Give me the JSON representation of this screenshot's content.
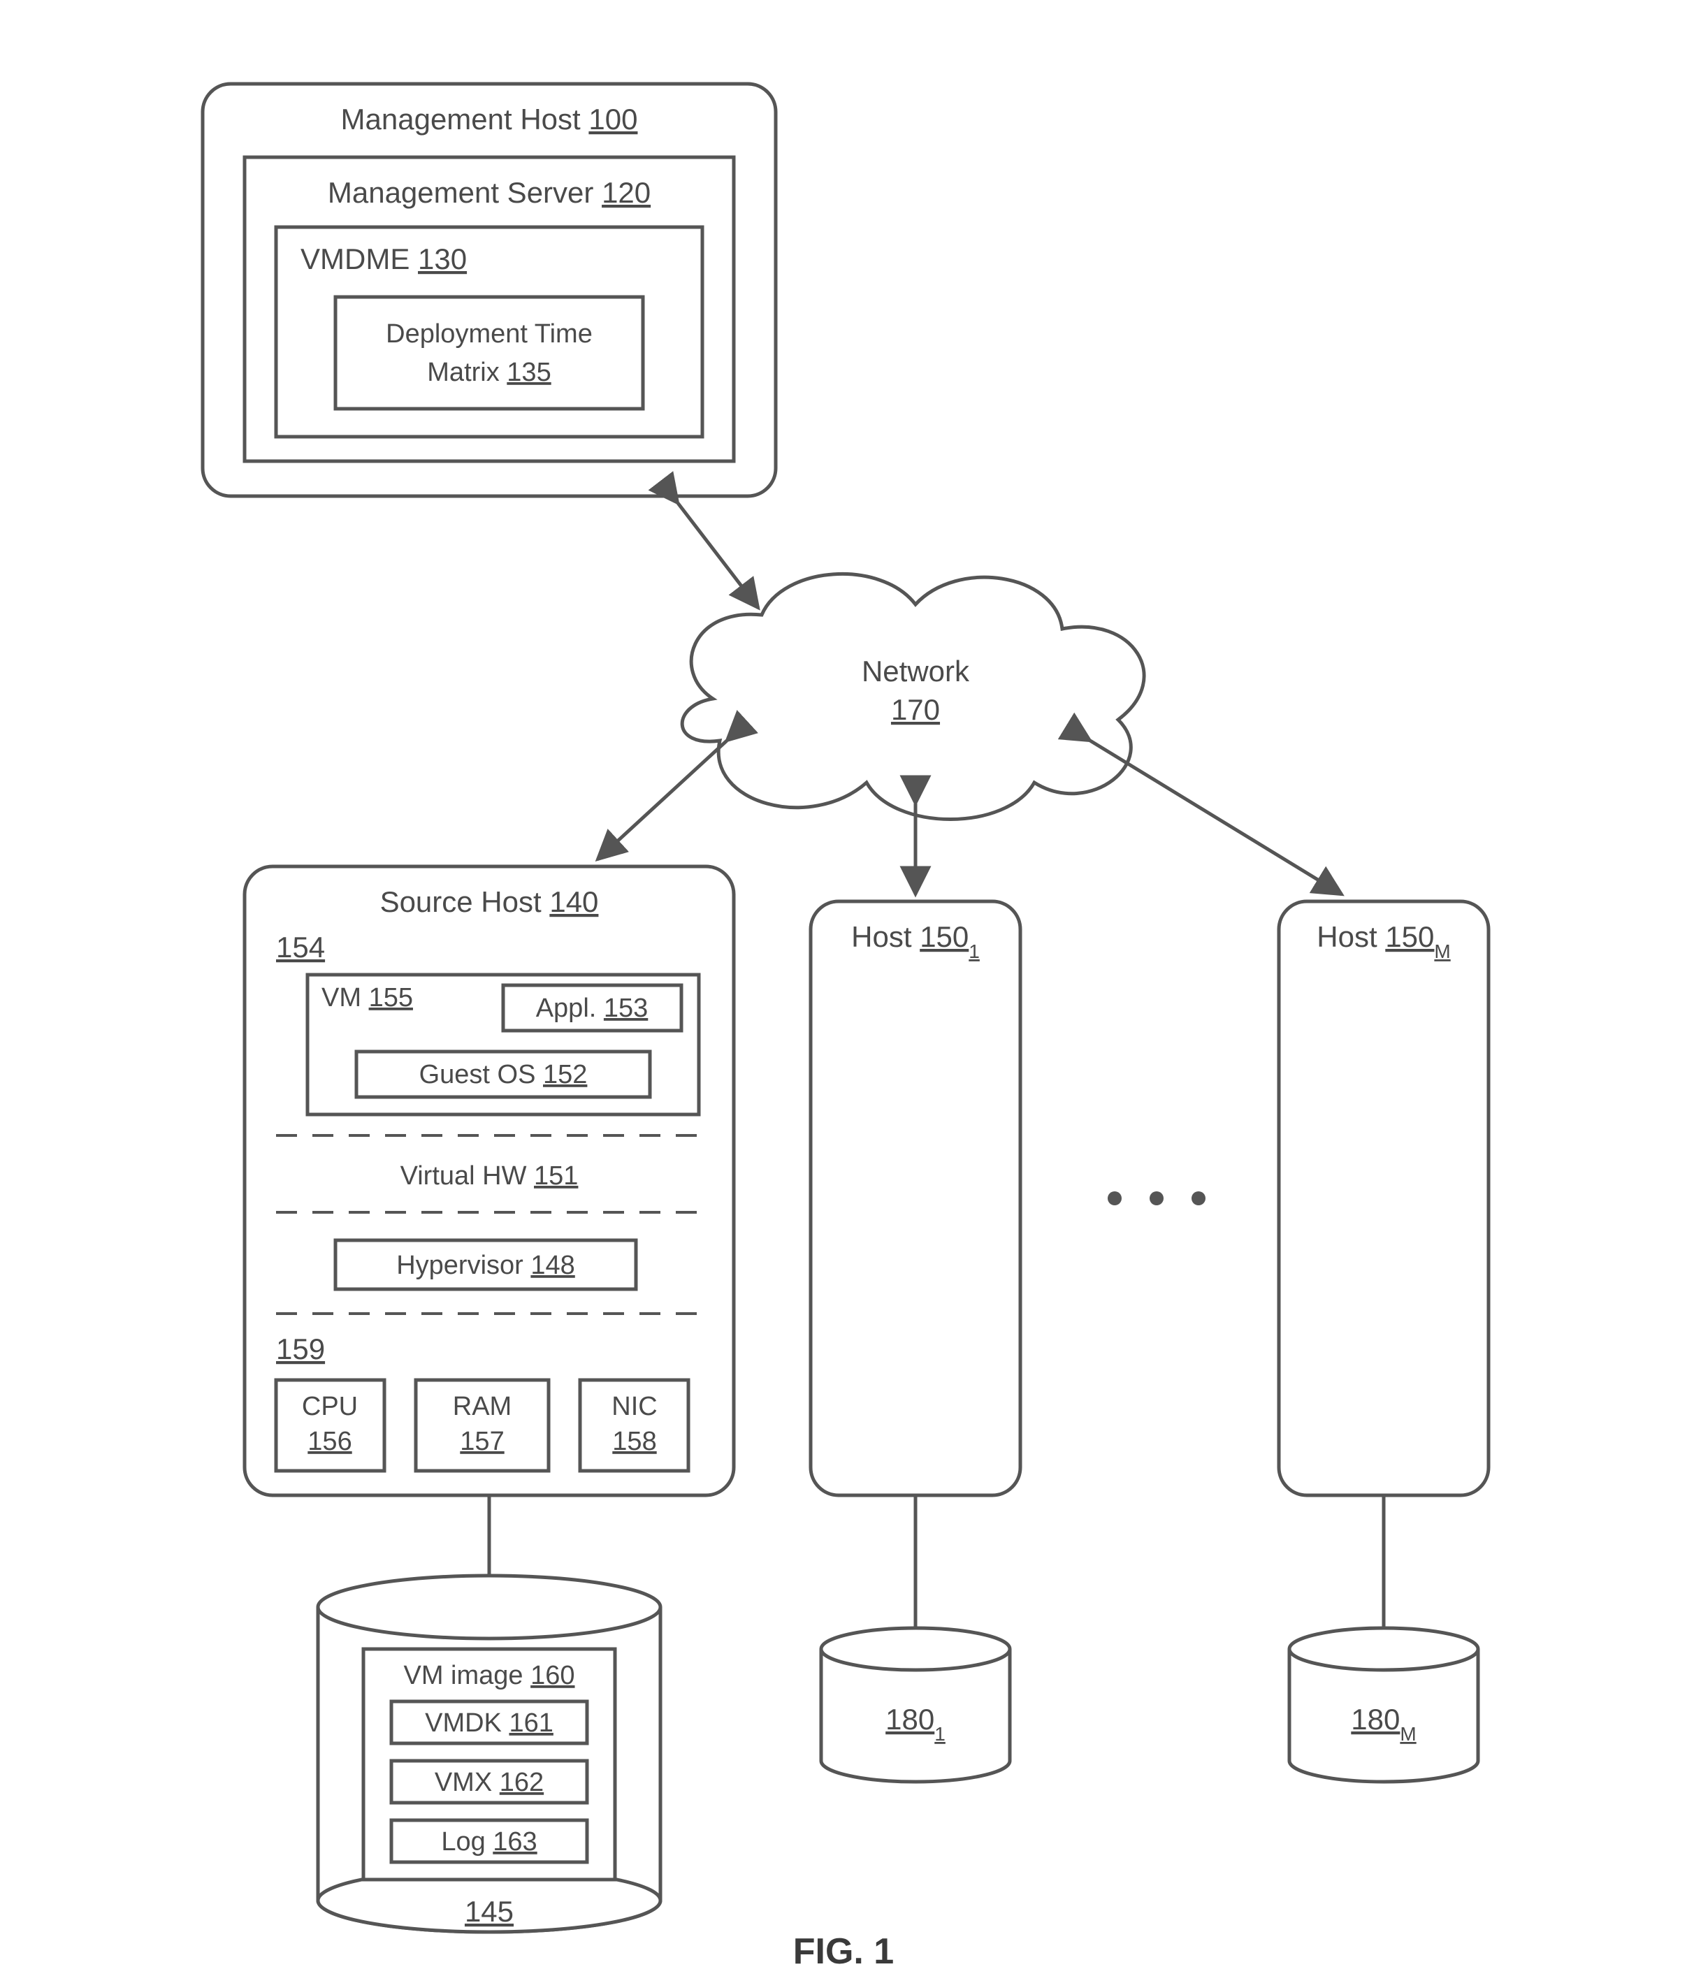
{
  "figure": {
    "caption": "FIG. 1"
  },
  "mgmtHost": {
    "label": "Management Host",
    "ref": "100"
  },
  "mgmtServer": {
    "label": "Management Server",
    "ref": "120"
  },
  "vmdme": {
    "label": "VMDME",
    "ref": "130"
  },
  "dtm": {
    "line1": "Deployment Time",
    "line2": "Matrix",
    "ref": "135"
  },
  "network": {
    "label": "Network",
    "ref": "170"
  },
  "sourceHost": {
    "label": "Source Host",
    "ref": "140"
  },
  "upper154": {
    "ref": "154"
  },
  "vm": {
    "label": "VM",
    "ref": "155"
  },
  "appl": {
    "label": "Appl.",
    "ref": "153"
  },
  "guestOS": {
    "label": "Guest OS",
    "ref": "152"
  },
  "virtualHW": {
    "label": "Virtual HW",
    "ref": "151"
  },
  "hypervisor": {
    "label": "Hypervisor",
    "ref": "148"
  },
  "lower159": {
    "ref": "159"
  },
  "cpu": {
    "label": "CPU",
    "ref": "156"
  },
  "ram": {
    "label": "RAM",
    "ref": "157"
  },
  "nic": {
    "label": "NIC",
    "ref": "158"
  },
  "host1": {
    "label": "Host",
    "ref": "150",
    "sub": "1"
  },
  "hostM": {
    "label": "Host",
    "ref": "150",
    "sub": "M"
  },
  "disk145": {
    "ref": "145"
  },
  "vmimage": {
    "label": "VM image",
    "ref": "160"
  },
  "vmdk": {
    "label": "VMDK",
    "ref": "161"
  },
  "vmx": {
    "label": "VMX",
    "ref": "162"
  },
  "log": {
    "label": "Log",
    "ref": "163"
  },
  "disk1801": {
    "ref": "180",
    "sub": "1"
  },
  "disk180M": {
    "ref": "180",
    "sub": "M"
  }
}
